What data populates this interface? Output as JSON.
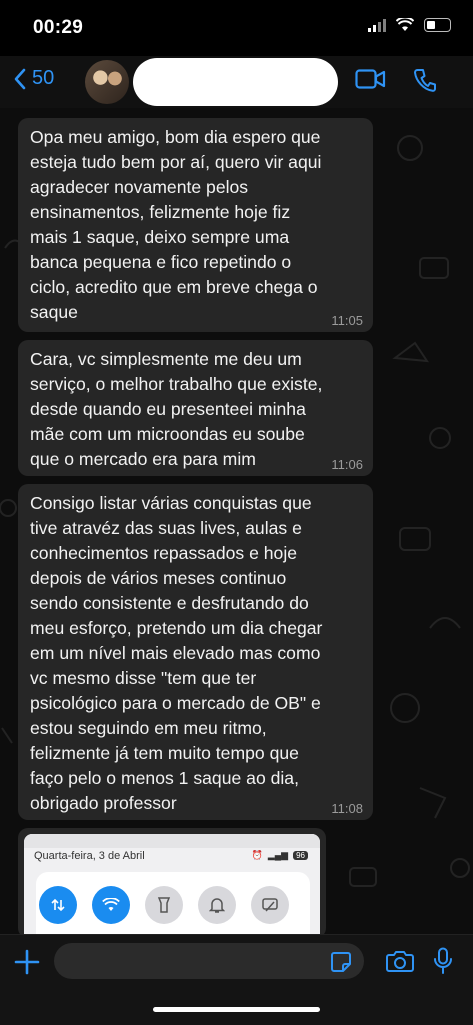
{
  "status_bar": {
    "time": "00:29"
  },
  "header": {
    "back_count": "50"
  },
  "messages": [
    {
      "text": "Opa meu amigo, bom dia espero que\nesteja tudo bem por aí, quero vir aqui\nagradecer novamente pelos\nensinamentos, felizmente hoje fiz\nmais 1 saque, deixo sempre uma\nbanca pequena e fico repetindo o\nciclo, acredito que em breve chega o\nsaque",
      "time": "11:05"
    },
    {
      "text": "Cara, vc simplesmente me deu um\nserviço, o melhor trabalho que existe,\ndesde quando eu presenteei minha\nmãe com um microondas eu soube\nque o mercado era para mim",
      "time": "11:06"
    },
    {
      "text": "Consigo listar várias conquistas que\ntive atravéz das suas lives, aulas e\nconhecimentos repassados e hoje\ndepois de vários meses continuo\nsendo consistente e desfrutando do\nmeu esforço, pretendo um dia chegar\nem um nível mais elevado mas como\nvc mesmo disse \"tem que ter\npsicológico para o mercado de OB\" e\nestou seguindo em meu ritmo,\nfelizmente já tem muito tempo que\nfaço pelo o menos 1 saque ao dia,\nobrigado professor",
      "time": "11:08"
    }
  ],
  "image_message": {
    "date_text": "Quarta-feira, 3 de Abril",
    "battery": "96"
  },
  "icons": {
    "back": "chevron-left-icon",
    "video": "video-camera-icon",
    "phone": "phone-icon",
    "plus": "plus-icon",
    "sticker": "sticker-icon",
    "camera": "camera-icon",
    "mic": "microphone-icon"
  },
  "colors": {
    "accent": "#2f93f4",
    "bubble": "#262626",
    "background": "#0d0d0d"
  }
}
